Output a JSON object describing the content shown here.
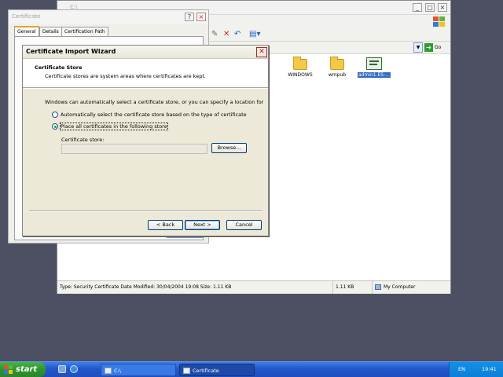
{
  "explorer": {
    "title": "C:\\",
    "toolbar_icons": [
      "move-to-icon",
      "delete-icon",
      "undo-icon",
      "views-icon"
    ],
    "files": [
      {
        "name": "WINDOWS",
        "icon": "folder-icon",
        "selected": false
      },
      {
        "name": "wmpub",
        "icon": "folder-icon",
        "selected": false
      },
      {
        "name": "admin1.ES-...",
        "icon": "certificate-file-icon",
        "selected": true
      }
    ],
    "go_label": "Go",
    "status": {
      "description": "Type: Security Certificate Date Modified: 30/04/2004 19:08 Size: 1.11 KB",
      "size": "1.11 KB",
      "location": "My Computer"
    }
  },
  "certificate_window": {
    "title": "Certificate",
    "tabs": [
      "General",
      "Details",
      "Certification Path"
    ],
    "active_tab": "General"
  },
  "wizard": {
    "title": "Certificate Import Wizard",
    "header_title": "Certificate Store",
    "header_subtitle": "Certificate stores are system areas where certificates are kept.",
    "intro": "Windows can automatically select a certificate store, or you can specify a location for",
    "option_auto": "Automatically select the certificate store based on the type of certificate",
    "option_place": "Place all certificates in the following store",
    "selected_option": "place",
    "store_label": "Certificate store:",
    "store_value": "",
    "browse_label": "Browse...",
    "back_label": "< Back",
    "next_label": "Next >",
    "cancel_label": "Cancel"
  },
  "taskbar": {
    "start_label": "start",
    "tasks": [
      {
        "label": "C:\\",
        "active": false
      },
      {
        "label": "Certificate",
        "active": true
      }
    ],
    "language": "EN",
    "clock": "19:41"
  },
  "colors": {
    "desktop": "#4d4f63",
    "taskbar": "#2357c9",
    "start_button": "#2f942f",
    "selection": "#316ac5",
    "dialog_face": "#ece9d8"
  }
}
